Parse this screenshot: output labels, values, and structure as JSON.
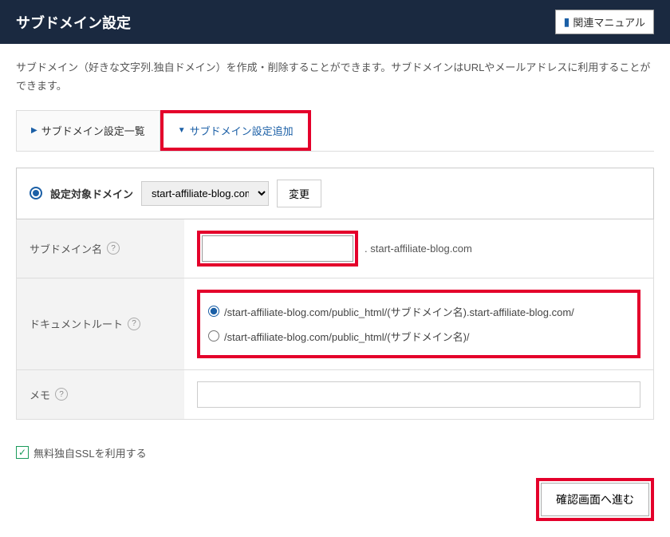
{
  "header": {
    "title": "サブドメイン設定",
    "manual_button": "関連マニュアル"
  },
  "description": "サブドメイン（好きな文字列.独自ドメイン）を作成・削除することができます。サブドメインはURLやメールアドレスに利用することができます。",
  "tabs": {
    "list": "サブドメイン設定一覧",
    "add": "サブドメイン設定追加"
  },
  "form": {
    "target_label": "設定対象ドメイン",
    "target_value": "start-affiliate-blog.com",
    "change_button": "変更",
    "subdomain_label": "サブドメイン名",
    "subdomain_value": "",
    "subdomain_suffix": ". start-affiliate-blog.com",
    "docroot_label": "ドキュメントルート",
    "docroot_option1": "/start-affiliate-blog.com/public_html/(サブドメイン名).start-affiliate-blog.com/",
    "docroot_option2": "/start-affiliate-blog.com/public_html/(サブドメイン名)/",
    "memo_label": "メモ",
    "memo_value": "",
    "ssl_label": "無料独自SSLを利用する",
    "submit_button": "確認画面へ進む"
  }
}
